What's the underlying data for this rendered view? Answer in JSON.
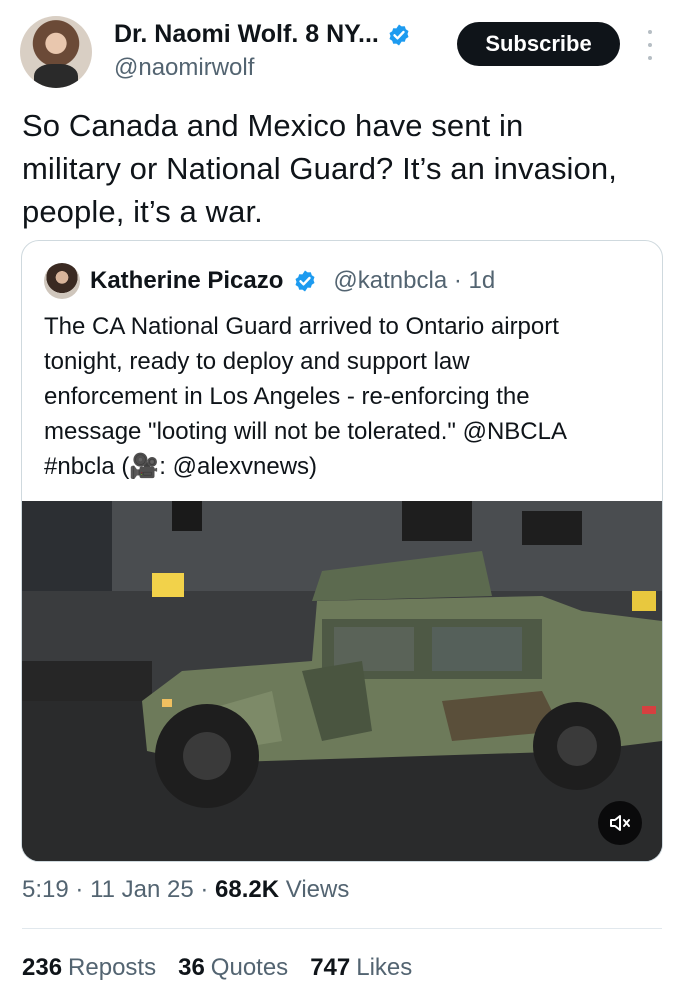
{
  "author": {
    "name": "Dr. Naomi Wolf. 8 NY...",
    "handle": "@naomirwolf",
    "verified_icon": "verified-badge-icon"
  },
  "header": {
    "subscribe_label": "Subscribe"
  },
  "tweet": {
    "text": "So Canada and Mexico have sent in\nmilitary or National Guard? It’s an invasion,\npeople, it’s a war."
  },
  "quoted": {
    "name": "Katherine Picazo",
    "handle": "@katnbcla · 1d",
    "text": "The CA National Guard arrived to Ontario airport\ntonight, ready to deploy and support law\nenforcement in Los Angeles - re-enforcing the\nmessage \"looting will not be tolerated.\" @NBCLA\n#nbcla (🎥: @alexvnews)"
  },
  "meta": {
    "time": "5:19",
    "date": "11 Jan 25",
    "views_count": "68.2K",
    "views_label": "Views"
  },
  "stats": {
    "reposts_count": "236",
    "reposts_label": "Reposts",
    "quotes_count": "36",
    "quotes_label": "Quotes",
    "likes_count": "747",
    "likes_label": "Likes"
  },
  "colors": {
    "accent": "#1d9bf0",
    "text": "#0f1419",
    "muted": "#536471"
  }
}
